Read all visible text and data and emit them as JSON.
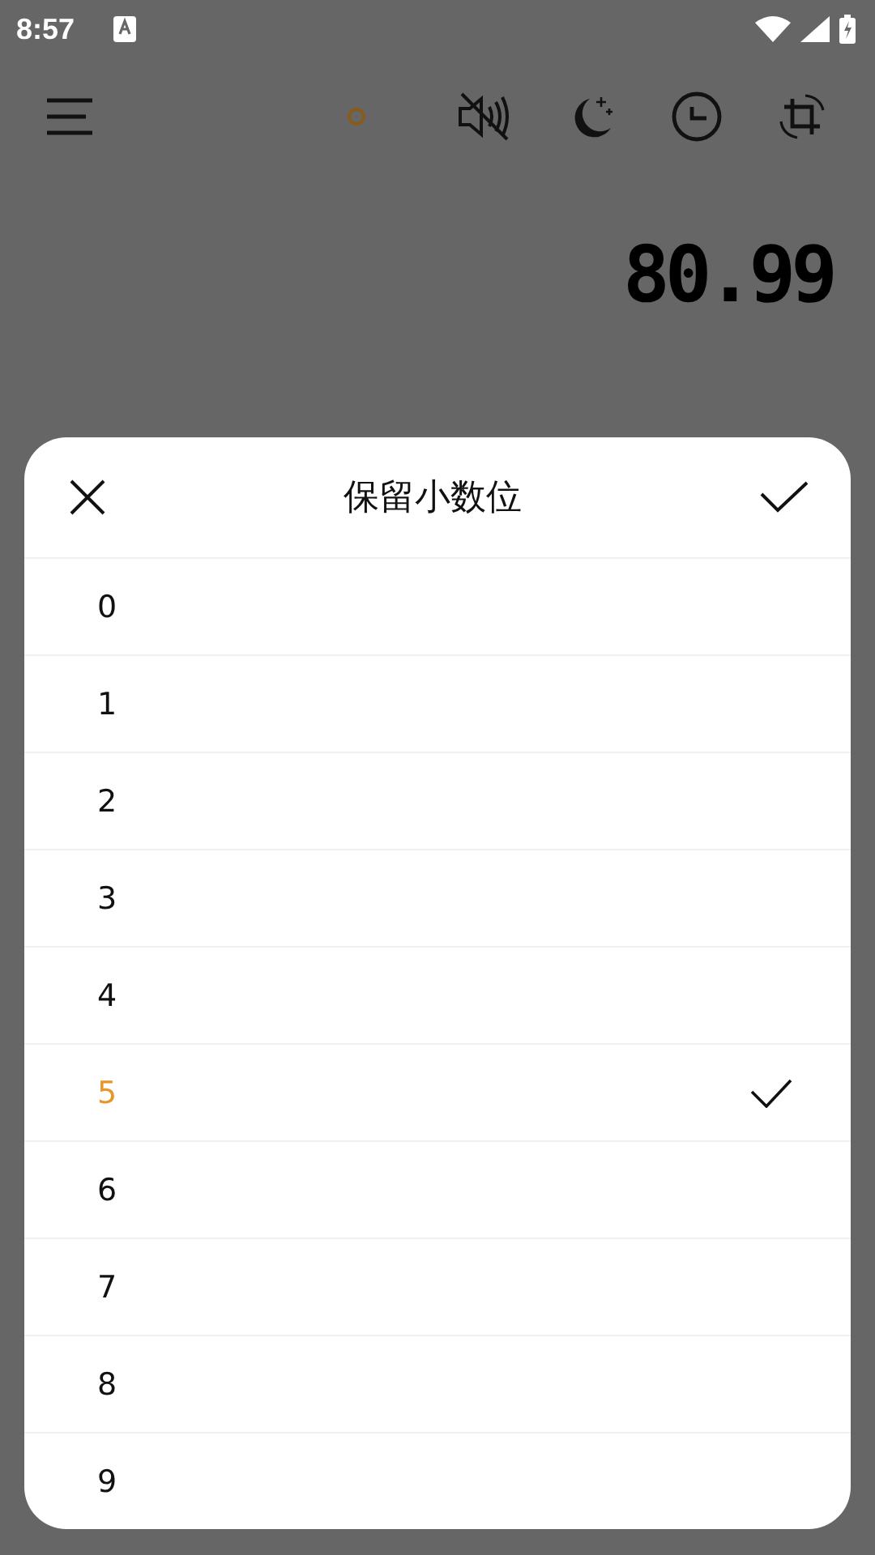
{
  "status_bar": {
    "time": "8:57"
  },
  "display": {
    "value": "80.99"
  },
  "sheet": {
    "title": "保留小数位",
    "options": [
      {
        "label": "0",
        "selected": false
      },
      {
        "label": "1",
        "selected": false
      },
      {
        "label": "2",
        "selected": false
      },
      {
        "label": "3",
        "selected": false
      },
      {
        "label": "4",
        "selected": false
      },
      {
        "label": "5",
        "selected": true
      },
      {
        "label": "6",
        "selected": false
      },
      {
        "label": "7",
        "selected": false
      },
      {
        "label": "8",
        "selected": false
      },
      {
        "label": "9",
        "selected": false
      }
    ]
  }
}
